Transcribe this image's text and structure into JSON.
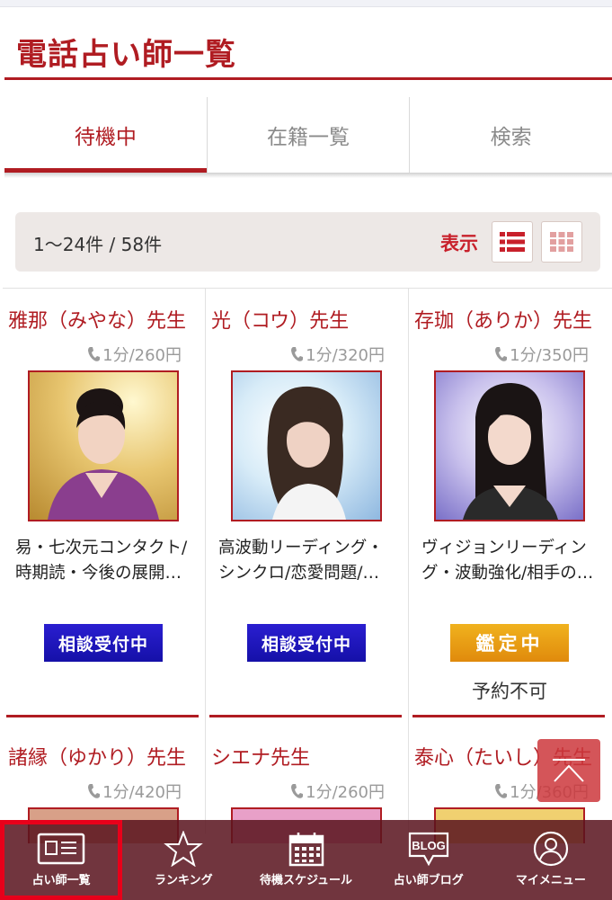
{
  "page": {
    "title": "電話占い師一覧"
  },
  "tabs": [
    {
      "label": "待機中",
      "active": true
    },
    {
      "label": "在籍一覧",
      "active": false
    },
    {
      "label": "検索",
      "active": false
    }
  ],
  "results": {
    "count_text": "1〜24件 / 58件",
    "view_label": "表示"
  },
  "cards": [
    {
      "name": "雅那（みやな）先生",
      "price": "1分/260円",
      "description": "易・七次元コンタクト/時期読・今後の展開…",
      "status": "相談受付中",
      "status_type": "accepting",
      "note": ""
    },
    {
      "name": "光（コウ）先生",
      "price": "1分/320円",
      "description": "高波動リーディング・シンクロ/恋愛問題/…",
      "status": "相談受付中",
      "status_type": "accepting",
      "note": ""
    },
    {
      "name": "存珈（ありか）先生",
      "price": "1分/350円",
      "description": "ヴィジョンリーディング・波動強化/相手の…",
      "status": "鑑定中",
      "status_type": "busy",
      "note": "予約不可"
    }
  ],
  "cards_row2": [
    {
      "name": "諸縁（ゆかり）先生",
      "price": "1分/420円"
    },
    {
      "name": "シエナ先生",
      "price": "1分/260円"
    },
    {
      "name": "泰心（たいし）先生",
      "price": "1分/360円"
    }
  ],
  "bottom_nav": [
    {
      "label": "占い師一覧",
      "icon": "list-card-icon",
      "current": true
    },
    {
      "label": "ランキング",
      "icon": "star-icon",
      "current": false
    },
    {
      "label": "待機スケジュール",
      "icon": "calendar-icon",
      "current": false
    },
    {
      "label": "占い師ブログ",
      "icon": "blog-icon",
      "current": false
    },
    {
      "label": "マイメニュー",
      "icon": "user-icon",
      "current": false
    }
  ],
  "colors": {
    "brand": "#b01c22",
    "accepting": "#1a14c0",
    "busy": "#e99a14"
  }
}
